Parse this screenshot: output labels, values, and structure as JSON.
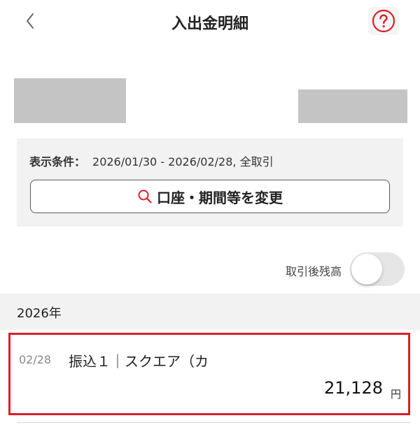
{
  "header": {
    "title": "入出金明細",
    "back_icon": "chevron-left-icon",
    "help_icon": "question-circle-icon",
    "accent_color": "#d9202b"
  },
  "conditions": {
    "label": "表示条件：",
    "value": "2026/01/30 - 2026/02/28, 全取引",
    "change_button_label": "口座・期間等を変更",
    "change_button_icon": "search-icon"
  },
  "balance_toggle": {
    "label": "取引後残高",
    "enabled": false
  },
  "year_header": "2026年",
  "transaction": {
    "date": "02/28",
    "description": "振込１｜スクエア（カ",
    "amount": "21,128",
    "unit": "円"
  }
}
